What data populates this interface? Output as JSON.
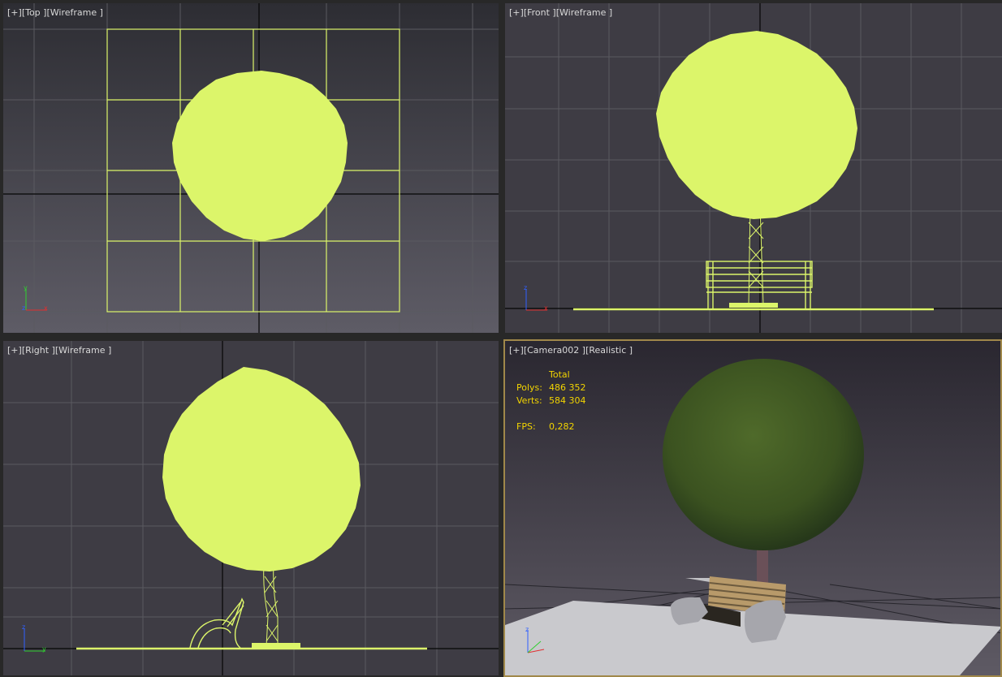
{
  "viewports": {
    "top": {
      "plus": "[+]",
      "view": "[Top ]",
      "mode": "[Wireframe ]"
    },
    "front": {
      "plus": "[+]",
      "view": "[Front ]",
      "mode": "[Wireframe ]"
    },
    "right": {
      "plus": "[+]",
      "view": "[Right ]",
      "mode": "[Wireframe ]"
    },
    "camera": {
      "plus": "[+]",
      "view": "[Camera002 ]",
      "mode": "[Realistic ]"
    }
  },
  "stats": {
    "header": "Total",
    "polys_label": "Polys:",
    "polys_value": "486 352",
    "verts_label": "Verts:",
    "verts_value": "584 304",
    "fps_label": "FPS:",
    "fps_value": "0,282"
  },
  "axis": {
    "x": "x",
    "y": "y",
    "z": "z"
  },
  "colors": {
    "wireframe": "#dcf56a",
    "stats_text": "#f2d400",
    "active_border": "#a0884a",
    "x_axis": "#e03030",
    "y_axis": "#30d030",
    "z_axis": "#3060ff"
  }
}
